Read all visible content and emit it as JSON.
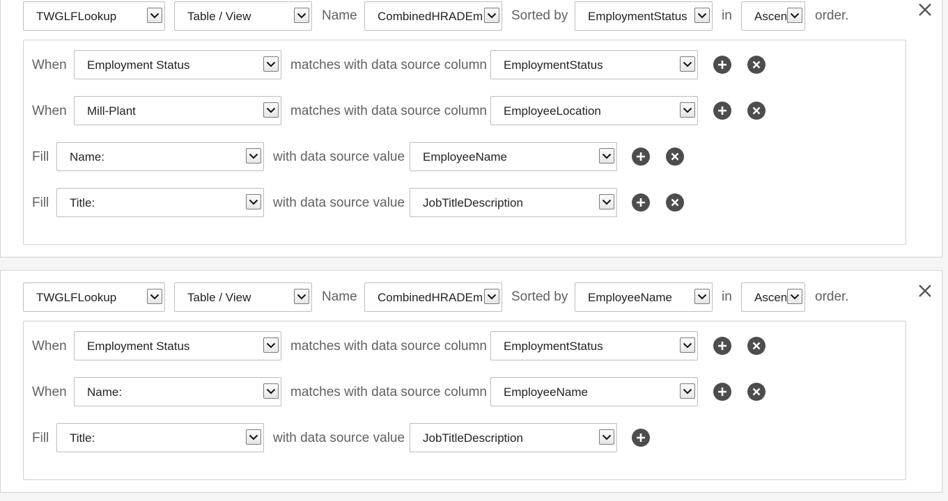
{
  "labels": {
    "name": "Name",
    "sorted_by": "Sorted by",
    "in": "in",
    "order": "order.",
    "when": "When",
    "fill": "Fill",
    "matches": "matches with data source column",
    "with_value": "with data source value"
  },
  "lookups": [
    {
      "source": "TWGLFLookup",
      "object_type": "Table / View",
      "name": "CombinedHRADEm",
      "sort_column": "EmploymentStatus",
      "sort_order": "Ascen",
      "conditions": [
        {
          "field": "Employment Status",
          "column": "EmploymentStatus"
        },
        {
          "field": "Mill-Plant",
          "column": "EmployeeLocation"
        }
      ],
      "fills": [
        {
          "field": "Name:",
          "value": "EmployeeName"
        },
        {
          "field": "Title:",
          "value": "JobTitleDescription"
        }
      ]
    },
    {
      "source": "TWGLFLookup",
      "object_type": "Table / View",
      "name": "CombinedHRADEm",
      "sort_column": "EmployeeName",
      "sort_order": "Ascen",
      "conditions": [
        {
          "field": "Employment Status",
          "column": "EmploymentStatus"
        },
        {
          "field": "Name:",
          "column": "EmployeeName"
        }
      ],
      "fills": [
        {
          "field": "Title:",
          "value": "JobTitleDescription"
        }
      ]
    }
  ],
  "icons": {
    "add": "plus-circle-icon",
    "remove": "x-circle-icon",
    "close": "close-icon",
    "dropdown": "chevron-down-icon"
  },
  "colors": {
    "icon_fill": "#4d4d4d",
    "label_text": "#616161",
    "border": "#bdbdbd"
  }
}
